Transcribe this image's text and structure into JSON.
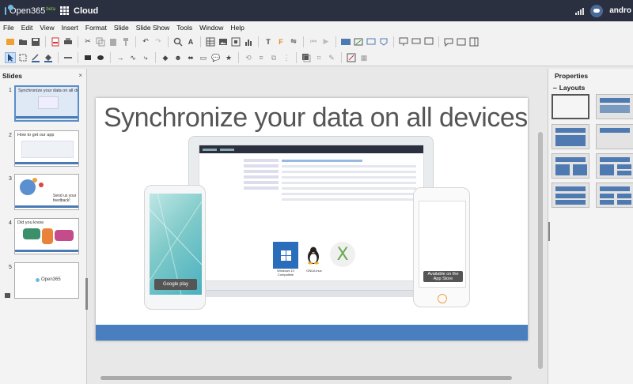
{
  "topbar": {
    "brand": "Open365",
    "brand_sub": "beta",
    "app_title": "Cloud",
    "user": "andro"
  },
  "menu": [
    "File",
    "Edit",
    "View",
    "Insert",
    "Format",
    "Slide",
    "Slide Show",
    "Tools",
    "Window",
    "Help"
  ],
  "slides_panel": {
    "title": "Slides",
    "close": "×",
    "thumbnails": [
      {
        "num": "1",
        "title": "Synchronize your data on all devices"
      },
      {
        "num": "2",
        "title": "How to get our app"
      },
      {
        "num": "3",
        "title": "Send us your feedback!"
      },
      {
        "num": "4",
        "title": "Did you know"
      },
      {
        "num": "5",
        "title": "Open365"
      }
    ]
  },
  "slide": {
    "title": "Synchronize your data on all devices",
    "google_play": "Google play",
    "app_store": "Available on the App Store",
    "windows_caption": "Windows 10 Compatible",
    "linux_caption": "GNU/Linux",
    "mac_caption": "X"
  },
  "properties": {
    "title": "Properties",
    "layouts_label": "Layouts"
  }
}
